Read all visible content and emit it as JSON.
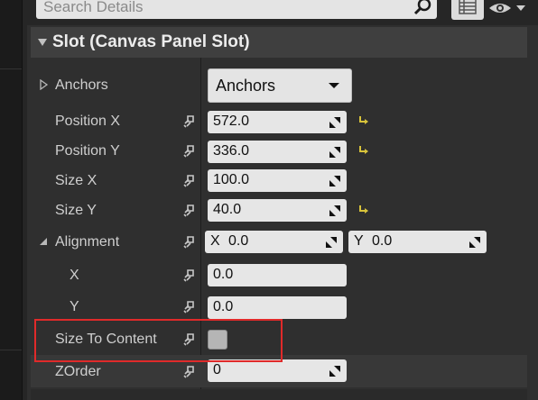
{
  "search": {
    "placeholder": "Search Details"
  },
  "section": {
    "title": "Slot (Canvas Panel Slot)"
  },
  "anchors": {
    "label": "Anchors",
    "dropdown_value": "Anchors"
  },
  "position_x": {
    "label": "Position X",
    "value": "572.0"
  },
  "position_y": {
    "label": "Position Y",
    "value": "336.0"
  },
  "size_x": {
    "label": "Size X",
    "value": "100.0"
  },
  "size_y": {
    "label": "Size Y",
    "value": "40.0"
  },
  "alignment": {
    "label": "Alignment",
    "x_prefix": "X",
    "x_value": "0.0",
    "y_prefix": "Y",
    "y_value": "0.0",
    "x_row_label": "X",
    "x_row_value": "0.0",
    "y_row_label": "Y",
    "y_row_value": "0.0"
  },
  "size_to_content": {
    "label": "Size To Content",
    "checked": false
  },
  "zorder": {
    "label": "ZOrder",
    "value": "0"
  },
  "colors": {
    "reset_arrow": "#d8c33a",
    "highlight_box": "#e02a2a",
    "field_bg": "#e6e6e6"
  }
}
